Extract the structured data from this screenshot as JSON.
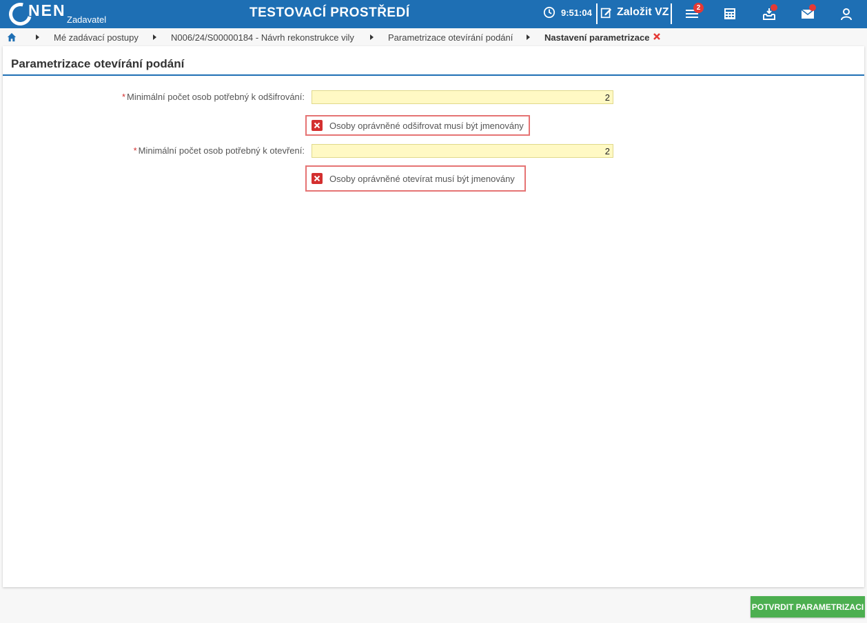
{
  "header": {
    "logo_text": "NEN",
    "logo_sub": "Zadavatel",
    "env_title": "TESTOVACÍ PROSTŘEDÍ",
    "clock_time": "9:51:04",
    "create_label": "Založit VZ",
    "menu_badge": "2",
    "icons": [
      "clock-icon",
      "edit-icon",
      "menu-icon",
      "calculator-icon",
      "inbox-icon",
      "mail-icon",
      "user-icon"
    ],
    "color": "#1e6fb4"
  },
  "breadcrumb": {
    "items": [
      "Mé zadávací postupy",
      "N006/24/S00000184 - Návrh rekonstrukce vily",
      "Parametrizace otevírání podání"
    ],
    "current": "Nastavení parametrizace"
  },
  "panel": {
    "title": "Parametrizace otevírání podání",
    "fields": [
      {
        "label": "Minimální počet osob potřebný k odšifrování:",
        "value": "2",
        "error": "Osoby oprávněné odšifrovat musí být jmenovány"
      },
      {
        "label": "Minimální počet osob potřebný k otevření:",
        "value": "2",
        "error": "Osoby oprávněné otevírat musí být jmenovány"
      }
    ]
  },
  "footer": {
    "confirm_label": "POTVRDIT PARAMETRIZACI",
    "confirm_color": "#4caf50"
  }
}
